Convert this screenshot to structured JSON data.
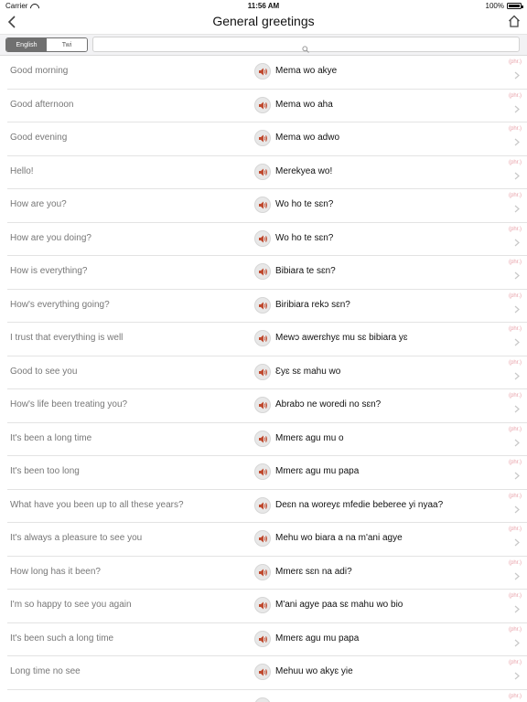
{
  "status_bar": {
    "carrier": "Carrier",
    "time": "11:56 AM",
    "battery": "100%",
    "battery_level": 1.0
  },
  "nav": {
    "title": "General greetings",
    "back_icon": "chevron-left-icon",
    "home_icon": "home-icon"
  },
  "toolbar": {
    "segments": [
      {
        "label": "English",
        "active": true
      },
      {
        "label": "Twi",
        "active": false
      }
    ],
    "search": {
      "placeholder": "",
      "value": ""
    }
  },
  "row_tag": "(phr.)",
  "accent_color": "#c0492e",
  "rows": [
    {
      "english": "Good morning",
      "twi": "Mema wo akye"
    },
    {
      "english": "Good afternoon",
      "twi": "Mema wo aha"
    },
    {
      "english": "Good evening",
      "twi": "Mema wo adwo"
    },
    {
      "english": "Hello!",
      "twi": "Merekyea wo!"
    },
    {
      "english": "How are you?",
      "twi": "Wo ho te sɛn?"
    },
    {
      "english": "How are you doing?",
      "twi": "Wo ho te sɛn?"
    },
    {
      "english": "How is everything?",
      "twi": "Bibiara te sɛn?"
    },
    {
      "english": "How's everything going?",
      "twi": "Biribiara rekɔ sɛn?"
    },
    {
      "english": "I trust that everything is well",
      "twi": "Mewɔ awerɛhyɛ mu sɛ bibiara yɛ"
    },
    {
      "english": "Good to see you",
      "twi": "Ɛyɛ sɛ mahu wo"
    },
    {
      "english": "How's life been treating you?",
      "twi": "Abrabɔ ne woredi no sɛn?"
    },
    {
      "english": "It's been a long time",
      "twi": "Mmerɛ agu mu o"
    },
    {
      "english": "It's been too long",
      "twi": "Mmerɛ agu mu papa"
    },
    {
      "english": "What have you been up to all these years?",
      "twi": "Deɛn na woreyɛ mfedie beberee yi nyaa?"
    },
    {
      "english": "It's always a pleasure to see you",
      "twi": "Mehu wo biara a na m'ani agye"
    },
    {
      "english": "How long has it been?",
      "twi": "Mmerɛ sɛn na adi?"
    },
    {
      "english": "I'm so happy to see you again",
      "twi": "M'ani agye paa sɛ mahu wo bio"
    },
    {
      "english": "It's been such a long time",
      "twi": "Mmerɛ agu mu papa"
    },
    {
      "english": "Long time no see",
      "twi": "Mehuu wo akyɛ yie"
    },
    {
      "english": "",
      "twi": ""
    }
  ]
}
